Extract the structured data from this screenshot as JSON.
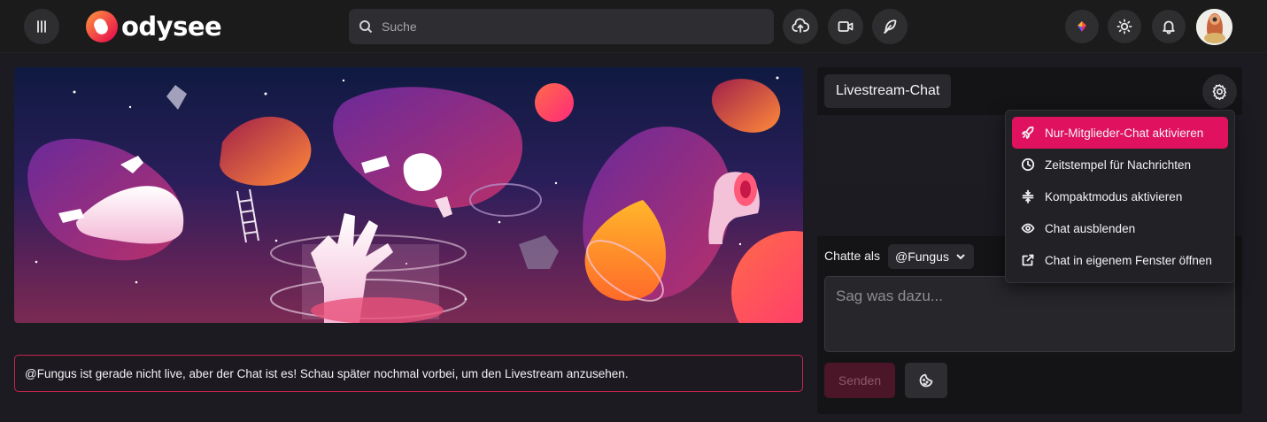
{
  "header": {
    "logo_text": "odysee",
    "search_placeholder": "Suche"
  },
  "notice": {
    "text": "@Fungus ist gerade nicht live, aber der Chat ist es! Schau später nochmal vorbei, um den Livestream anzusehen."
  },
  "chat": {
    "title": "Livestream-Chat",
    "chat_as_label": "Chatte als",
    "selected_user": "@Fungus",
    "input_placeholder": "Sag was dazu...",
    "send_label": "Senden"
  },
  "menu": {
    "items": [
      {
        "label": "Nur-Mitglieder-Chat aktivieren",
        "icon": "rocket-icon",
        "active": true
      },
      {
        "label": "Zeitstempel für Nachrichten",
        "icon": "clock-icon",
        "active": false
      },
      {
        "label": "Kompaktmodus aktivieren",
        "icon": "compact-icon",
        "active": false
      },
      {
        "label": "Chat ausblenden",
        "icon": "eye-icon",
        "active": false
      },
      {
        "label": "Chat in eigenem Fenster öffnen",
        "icon": "external-link-icon",
        "active": false
      }
    ]
  },
  "colors": {
    "accent": "#e0115f",
    "notice_border": "#c4254e",
    "background": "#1d1b22"
  }
}
